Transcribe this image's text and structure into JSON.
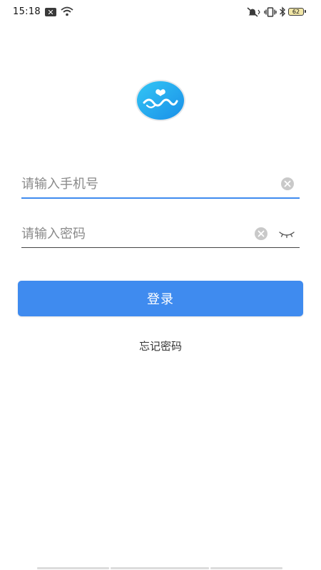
{
  "status_bar": {
    "time": "15:18",
    "battery_level": "62",
    "icons": [
      "notification-icon",
      "wifi-icon",
      "mute-icon",
      "vibrate-icon",
      "bluetooth-icon",
      "battery-icon"
    ]
  },
  "login_form": {
    "phone_placeholder": "请输入手机号",
    "phone_value": "",
    "password_placeholder": "请输入密码",
    "password_value": "",
    "login_label": "登录",
    "forgot_password_label": "忘记密码"
  },
  "colors": {
    "accent": "#3f8bef",
    "logo_gradient_start": "#33c6f5",
    "logo_gradient_end": "#1a8fe8",
    "clear_icon": "#c9c9c9"
  }
}
